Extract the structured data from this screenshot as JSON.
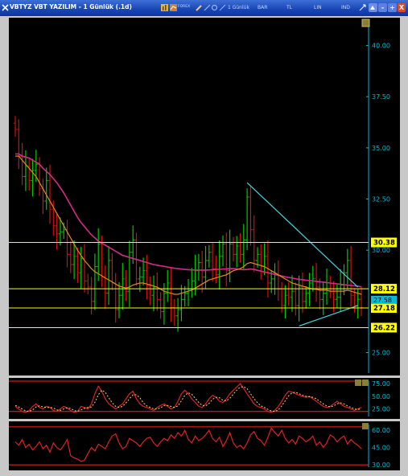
{
  "window": {
    "title": "VBTYZ VBT YAZILIM - 1 Günlük (.1d)",
    "toolbar": {
      "forex_label": "FOREX",
      "period_label": "1 Günlük",
      "bar_label": "BAR",
      "currency_label": "TL",
      "scale_label": "LIN",
      "ind_label": "IND"
    },
    "controls": {
      "minimize": "-",
      "maximize": "+",
      "close": "X"
    }
  },
  "colors": {
    "background": "#000000",
    "price_up": "#00c800",
    "price_down": "#d01010",
    "ma_long": "#d42b86",
    "ma_short": "#e08a1e",
    "level_lines": "#ffff00",
    "trend_lines": "#3fd6de",
    "axis_text": "#00bcd4",
    "stoch_main": "#e02020",
    "stoch_signal": "#ffd166",
    "panel_bounds": "#ff2020"
  },
  "price_axis": {
    "ticks": [
      "40.00",
      "37.50",
      "35.00",
      "32.50",
      "30.00",
      "25.00"
    ],
    "current_price": "27.58"
  },
  "levels": [
    {
      "label": "30.38",
      "value": 30.38
    },
    {
      "label": "28.12",
      "value": 28.12
    },
    {
      "label": "27.18",
      "value": 27.18
    },
    {
      "label": "26.22",
      "value": 26.22
    }
  ],
  "osc1": {
    "ticks": [
      "75.00",
      "50.00",
      "25.00"
    ]
  },
  "osc2": {
    "ticks": [
      "60.00",
      "45.00",
      "30.00"
    ]
  },
  "chart_data": {
    "type": "line",
    "price_range": [
      24.0,
      41.2
    ],
    "closes": [
      35.9,
      34.6,
      33.6,
      34.1,
      33.4,
      33.9,
      34.2,
      33.0,
      32.4,
      33.4,
      32.0,
      31.2,
      30.8,
      30.9,
      31.0,
      29.8,
      29.3,
      29.7,
      28.9,
      29.6,
      28.5,
      28.2,
      27.5,
      29.2,
      30.3,
      28.7,
      27.9,
      29.5,
      28.4,
      27.1,
      27.8,
      28.6,
      28.0,
      29.9,
      30.5,
      28.6,
      28.7,
      29.0,
      28.3,
      27.8,
      28.2,
      27.6,
      27.0,
      27.9,
      28.4,
      27.2,
      26.8,
      27.1,
      27.6,
      27.9,
      28.1,
      28.5,
      29.0,
      29.4,
      28.7,
      29.5,
      29.9,
      29.1,
      28.8,
      29.7,
      30.3,
      29.0,
      30.3,
      29.8,
      30.2,
      29.8,
      30.5,
      32.6,
      31.0,
      29.5,
      29.8,
      29.2,
      29.7,
      28.4,
      28.6,
      28.8,
      28.1,
      27.3,
      27.8,
      27.7,
      28.0,
      27.3,
      28.2,
      27.5,
      27.9,
      28.4,
      28.6,
      28.2,
      27.6,
      27.9,
      28.4,
      28.0,
      27.6,
      27.7,
      28.3,
      28.9,
      29.5,
      27.8,
      27.3,
      27.6,
      27.2
    ],
    "ma_long": [
      34.7,
      34.7,
      34.6,
      34.55,
      34.5,
      34.4,
      34.3,
      34.2,
      34.0,
      33.85,
      33.7,
      33.5,
      33.3,
      33.05,
      32.8,
      32.5,
      32.2,
      31.9,
      31.6,
      31.35,
      31.15,
      30.95,
      30.75,
      30.6,
      30.45,
      30.35,
      30.25,
      30.15,
      30.05,
      29.95,
      29.85,
      29.75,
      29.7,
      29.65,
      29.6,
      29.55,
      29.5,
      29.45,
      29.4,
      29.35,
      29.3,
      29.27,
      29.24,
      29.21,
      29.18,
      29.15,
      29.12,
      29.1,
      29.08,
      29.06,
      29.05,
      29.04,
      29.03,
      29.03,
      29.03,
      29.03,
      29.04,
      29.05,
      29.06,
      29.07,
      29.08,
      29.09,
      29.1,
      29.1,
      29.09,
      29.07,
      29.05,
      29.06,
      29.08,
      29.06,
      29.02,
      28.98,
      28.94,
      28.9,
      28.86,
      28.82,
      28.78,
      28.74,
      28.7,
      28.67,
      28.64,
      28.61,
      28.58,
      28.56,
      28.54,
      28.52,
      28.5,
      28.48,
      28.46,
      28.44,
      28.42,
      28.4,
      28.38,
      28.36,
      28.34,
      28.32,
      28.3,
      28.28,
      28.26,
      28.24,
      28.22
    ],
    "ma_short": [
      34.6,
      34.6,
      34.4,
      34.2,
      34.0,
      33.8,
      33.6,
      33.3,
      33.0,
      32.7,
      32.4,
      32.1,
      31.8,
      31.5,
      31.2,
      30.9,
      30.6,
      30.3,
      30.0,
      29.75,
      29.5,
      29.3,
      29.1,
      28.95,
      28.85,
      28.75,
      28.65,
      28.55,
      28.45,
      28.35,
      28.25,
      28.2,
      28.15,
      28.2,
      28.3,
      28.35,
      28.4,
      28.4,
      28.35,
      28.3,
      28.25,
      28.2,
      28.1,
      28.0,
      27.95,
      27.9,
      27.85,
      27.85,
      27.9,
      27.95,
      28.0,
      28.05,
      28.15,
      28.25,
      28.35,
      28.45,
      28.55,
      28.6,
      28.65,
      28.7,
      28.75,
      28.8,
      28.9,
      29.0,
      29.05,
      29.1,
      29.2,
      29.35,
      29.4,
      29.35,
      29.3,
      29.25,
      29.2,
      29.1,
      29.0,
      28.9,
      28.8,
      28.7,
      28.6,
      28.5,
      28.4,
      28.35,
      28.3,
      28.25,
      28.2,
      28.15,
      28.1,
      28.1,
      28.05,
      28.05,
      28.05,
      28.0,
      28.0,
      28.0,
      28.0,
      28.0,
      28.05,
      28.0,
      27.95,
      27.9,
      27.85
    ],
    "trendlines": [
      {
        "from": [
          67,
          33.3
        ],
        "to": [
          99,
          28.2
        ]
      },
      {
        "from": [
          82,
          26.3
        ],
        "to": [
          99,
          27.3
        ]
      }
    ],
    "stoch_range": [
      10,
      80
    ],
    "stoch_k": [
      30,
      25,
      20,
      18,
      22,
      30,
      35,
      28,
      25,
      30,
      28,
      22,
      20,
      25,
      30,
      27,
      22,
      18,
      20,
      30,
      28,
      25,
      35,
      55,
      70,
      60,
      45,
      35,
      30,
      25,
      30,
      35,
      45,
      55,
      60,
      45,
      35,
      30,
      28,
      25,
      22,
      28,
      32,
      35,
      30,
      25,
      28,
      40,
      55,
      62,
      55,
      45,
      38,
      30,
      28,
      35,
      45,
      52,
      48,
      40,
      38,
      45,
      55,
      62,
      68,
      75,
      65,
      55,
      45,
      35,
      30,
      28,
      25,
      20,
      18,
      22,
      30,
      40,
      52,
      60,
      58,
      55,
      52,
      50,
      48,
      50,
      45,
      40,
      35,
      30,
      28,
      30,
      35,
      40,
      35,
      30,
      28,
      25,
      22,
      25,
      28
    ],
    "stoch_d": [
      32,
      29,
      25,
      21,
      20,
      23,
      29,
      31,
      29,
      28,
      28,
      27,
      23,
      22,
      25,
      27,
      26,
      22,
      20,
      23,
      26,
      28,
      29,
      38,
      53,
      62,
      58,
      47,
      37,
      30,
      28,
      30,
      37,
      45,
      53,
      53,
      47,
      37,
      31,
      28,
      25,
      25,
      27,
      32,
      32,
      30,
      28,
      31,
      41,
      52,
      57,
      54,
      46,
      38,
      32,
      31,
      36,
      44,
      48,
      47,
      42,
      41,
      46,
      54,
      62,
      68,
      69,
      65,
      55,
      45,
      37,
      31,
      28,
      24,
      21,
      20,
      23,
      31,
      41,
      51,
      57,
      58,
      55,
      52,
      50,
      49,
      48,
      45,
      40,
      35,
      31,
      29,
      31,
      35,
      37,
      35,
      31,
      28,
      25,
      24,
      25
    ],
    "osc2_range": [
      28,
      65
    ],
    "osc2": [
      50,
      47,
      52,
      45,
      48,
      43,
      46,
      50,
      44,
      47,
      41,
      49,
      45,
      43,
      47,
      52,
      38,
      36,
      35,
      33,
      34,
      40,
      45,
      42,
      48,
      46,
      44,
      50,
      55,
      57,
      49,
      44,
      46,
      53,
      51,
      49,
      46,
      50,
      53,
      54,
      49,
      46,
      50,
      53,
      51,
      56,
      53,
      58,
      55,
      60,
      52,
      49,
      55,
      51,
      53,
      56,
      60,
      53,
      50,
      54,
      46,
      51,
      58,
      49,
      45,
      47,
      44,
      49,
      56,
      59,
      53,
      51,
      47,
      54,
      62,
      58,
      55,
      60,
      53,
      49,
      52,
      48,
      55,
      53,
      50,
      52,
      55,
      47,
      50,
      45,
      49,
      56,
      54,
      50,
      53,
      55,
      48,
      52,
      49,
      47,
      44
    ]
  }
}
